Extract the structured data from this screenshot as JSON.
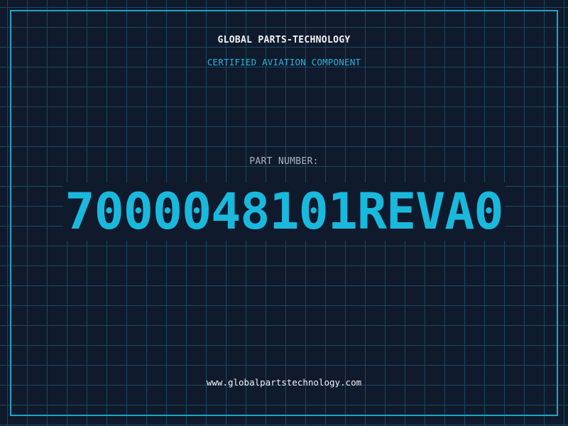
{
  "header": {
    "brand": "GLOBAL PARTS-TECHNOLOGY",
    "tagline": "CERTIFIED AVIATION COMPONENT"
  },
  "part": {
    "label": "PART NUMBER:",
    "number": "7000048101REVA0"
  },
  "footer": {
    "website": "www.globalpartstechnology.com"
  },
  "colors": {
    "background": "#101a2d",
    "grid": "#1a4a5e",
    "accent": "#19b9dd",
    "frame": "#1ea3c8",
    "text": "#f2f4f7",
    "muted": "#a8b4c4"
  }
}
